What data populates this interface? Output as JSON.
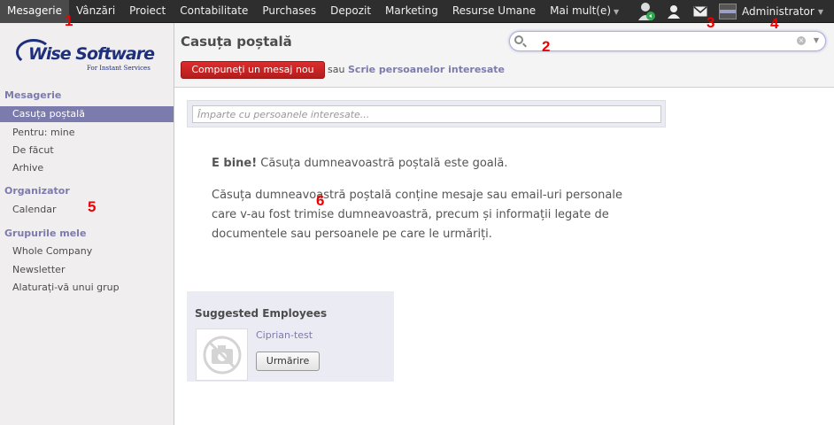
{
  "topbar": {
    "menu": [
      {
        "label": "Mesagerie",
        "active": true
      },
      {
        "label": "Vânzări"
      },
      {
        "label": "Proiect"
      },
      {
        "label": "Contabilitate"
      },
      {
        "label": "Purchases"
      },
      {
        "label": "Depozit"
      },
      {
        "label": "Marketing"
      },
      {
        "label": "Resurse Umane"
      },
      {
        "label": "Mai mult(e)",
        "dropdown": true
      }
    ],
    "user_name": "Administrator",
    "icons": [
      "user-status-icon",
      "user-icon",
      "mail-icon"
    ]
  },
  "sidebar": {
    "logo_text": "Wise Software",
    "logo_tagline": "For Instant Services",
    "sections": [
      {
        "title": "Mesagerie",
        "items": [
          "Casuța poștală",
          "Pentru: mine",
          "De făcut",
          "Arhive"
        ],
        "active_index": 0
      },
      {
        "title": "Organizator",
        "items": [
          "Calendar"
        ]
      },
      {
        "title": "Grupurile mele",
        "items": [
          "Whole Company",
          "Newsletter",
          "Alaturați-vă unui grup"
        ]
      }
    ]
  },
  "header": {
    "title": "Casuța poștală",
    "compose_label": "Compuneți un mesaj nou",
    "or_text": "sau",
    "write_link": "Scrie persoanelor interesate",
    "search_placeholder": ""
  },
  "main": {
    "share_placeholder": "Împarte cu persoanele interesate...",
    "empty_bold": "E bine!",
    "empty_rest": " Căsuța dumneavoastră poștală este goală.",
    "empty_body": "Căsuța dumneavoastră poștală conține mesaje sau email-uri personale care v-au fost trimise dumneavoastră, precum și informații legate de documentele sau persoanele pe care le urmăriți."
  },
  "suggestions": {
    "title": "Suggested Employees",
    "employee_name": "Ciprian-test",
    "follow_label": "Urmărire"
  },
  "markers": [
    "1",
    "2",
    "3",
    "4",
    "5",
    "6"
  ],
  "colors": {
    "accent": "#7c7bad",
    "topbar": "#2e2e2e",
    "compose": "#c52323"
  }
}
